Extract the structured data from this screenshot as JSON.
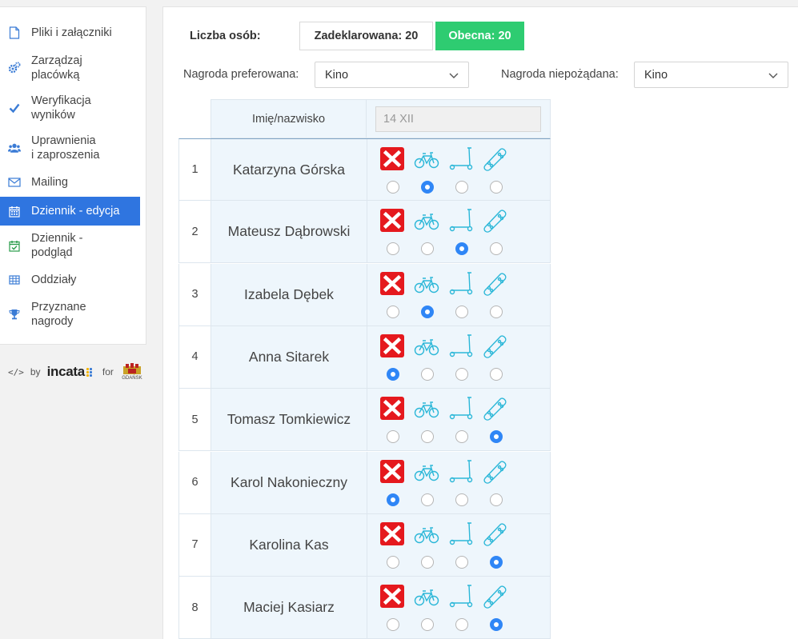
{
  "sidebar": {
    "items": [
      {
        "label": "Pliki i załączniki",
        "icon": "file-icon",
        "active": false
      },
      {
        "label": "Zarządzaj\nplacówką",
        "icon": "cogs-icon",
        "active": false
      },
      {
        "label": "Weryfikacja\nwyników",
        "icon": "check-icon",
        "active": false
      },
      {
        "label": "Uprawnienia\ni zaproszenia",
        "icon": "users-icon",
        "active": false
      },
      {
        "label": "Mailing",
        "icon": "envelope-icon",
        "active": false
      },
      {
        "label": "Dziennik - edycja",
        "icon": "calendar-icon",
        "active": true
      },
      {
        "label": "Dziennik -\npodgląd",
        "icon": "calendar-check-icon",
        "active": false
      },
      {
        "label": "Oddziały",
        "icon": "table-icon",
        "active": false
      },
      {
        "label": "Przyznane\nnagrody",
        "icon": "trophy-icon",
        "active": false
      }
    ]
  },
  "byline": {
    "by": "by",
    "brand": "incata",
    "for": "for",
    "partner": "GDAŃSK"
  },
  "counts": {
    "label": "Liczba osób:",
    "declared": "Zadeklarowana: 20",
    "present": "Obecna: 20"
  },
  "filters": {
    "preferred_label": "Nagroda preferowana:",
    "preferred_value": "Kino",
    "unwanted_label": "Nagroda niepożądana:",
    "unwanted_value": "Kino"
  },
  "table": {
    "name_header": "Imię/nazwisko",
    "date_placeholder": "14 XII",
    "options": [
      "absent-icon",
      "bicycle-icon",
      "scooter-icon",
      "skateboard-icon"
    ],
    "colors": {
      "absent": "#e5191e",
      "transport": "#2bb7d8",
      "radio_on": "#2f86f6"
    },
    "rows": [
      {
        "num": "1",
        "name": "Katarzyna Górska",
        "selected": 1
      },
      {
        "num": "2",
        "name": "Mateusz Dąbrowski",
        "selected": 2
      },
      {
        "num": "3",
        "name": "Izabela Dębek",
        "selected": 1
      },
      {
        "num": "4",
        "name": "Anna Sitarek",
        "selected": 0
      },
      {
        "num": "5",
        "name": "Tomasz Tomkiewicz",
        "selected": 3
      },
      {
        "num": "6",
        "name": "Karol Nakonieczny",
        "selected": 0
      },
      {
        "num": "7",
        "name": "Karolina Kas",
        "selected": 3
      },
      {
        "num": "8",
        "name": "Maciej Kasiarz",
        "selected": 3
      }
    ]
  }
}
